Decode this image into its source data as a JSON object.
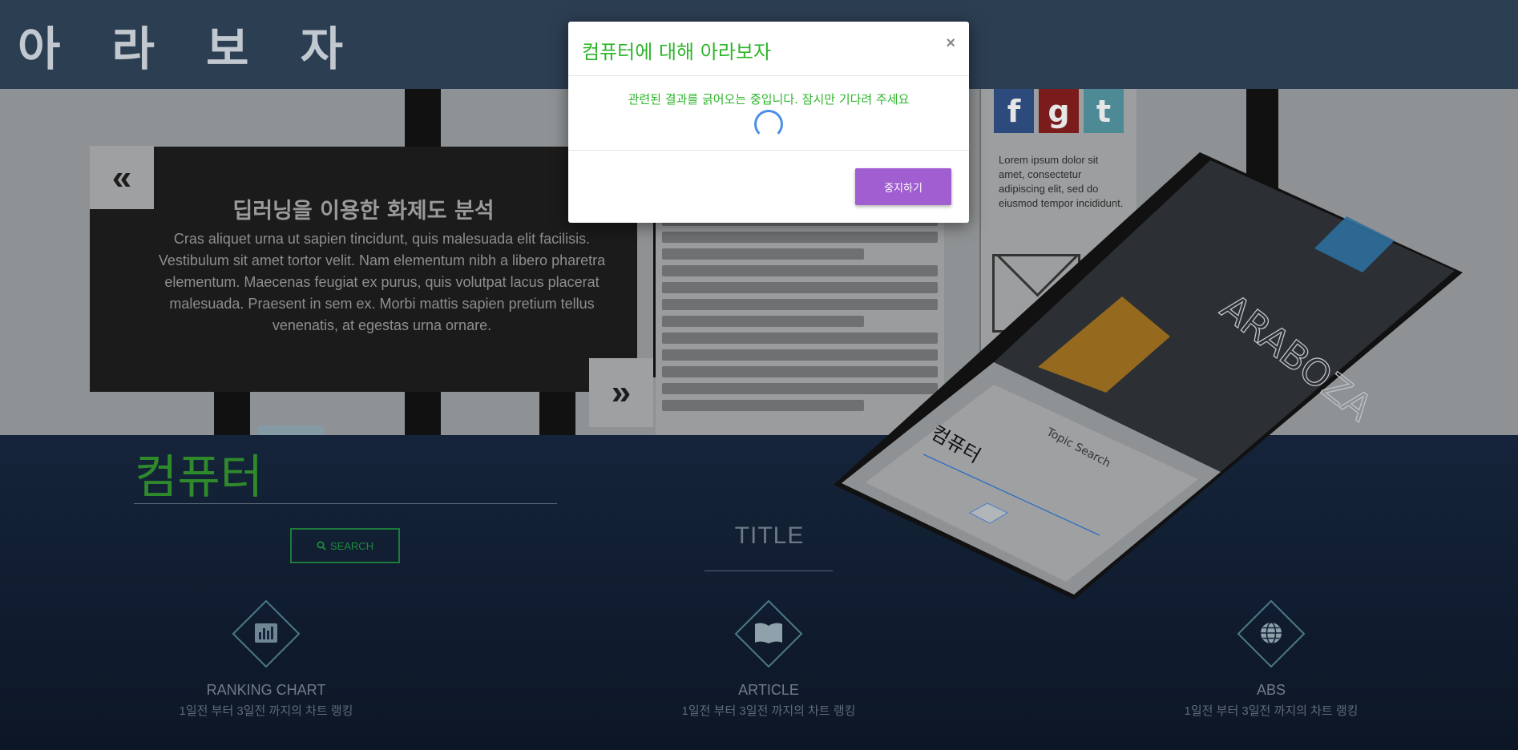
{
  "header": {
    "logo": "아 라 보 자"
  },
  "hero": {
    "slide_title": "딥러닝을 이용한 화제도 분석",
    "slide_body": "Cras aliquet urna ut sapien tincidunt, quis malesuada elit facilisis. Vestibulum sit amet tortor velit. Nam elementum nibh a libero pharetra elementum. Maecenas feugiat ex purus, quis volutpat lacus placerat malesuada. Praesent in sem ex. Morbi mattis sapien pretium tellus venenatis, at egestas urna ornare.",
    "prev_label": "«",
    "next_label": "»",
    "side_text": "Lorem ipsum dolor sit amet, consectetur adipiscing elit, sed do eiusmod tempor incididunt.",
    "social": {
      "facebook": "f",
      "google": "g",
      "tumblr": "t"
    }
  },
  "section": {
    "title": "컴퓨터",
    "search_label": "SEARCH",
    "center_title": "TITLE"
  },
  "features": [
    {
      "icon": "bar-chart-icon",
      "title": "RANKING CHART",
      "subtitle": "1일전 부터 3일전 까지의 차트 랭킹"
    },
    {
      "icon": "book-icon",
      "title": "ARTICLE",
      "subtitle": "1일전 부터 3일전 까지의 차트 랭킹"
    },
    {
      "icon": "globe-icon",
      "title": "ABS",
      "subtitle": "1일전 부터 3일전 까지의 차트 랭킹"
    }
  ],
  "mockup": {
    "brand": "ARABOZA",
    "screen_title": "컴퓨터",
    "topic_placeholder": "Topic Search"
  },
  "modal": {
    "title": "컴퓨터에 대해 아라보자",
    "close": "×",
    "message": "관련된 결과를 긁어오는 중입니다. 잠시만 기다려 주세요",
    "stop_label": "중지하기"
  }
}
